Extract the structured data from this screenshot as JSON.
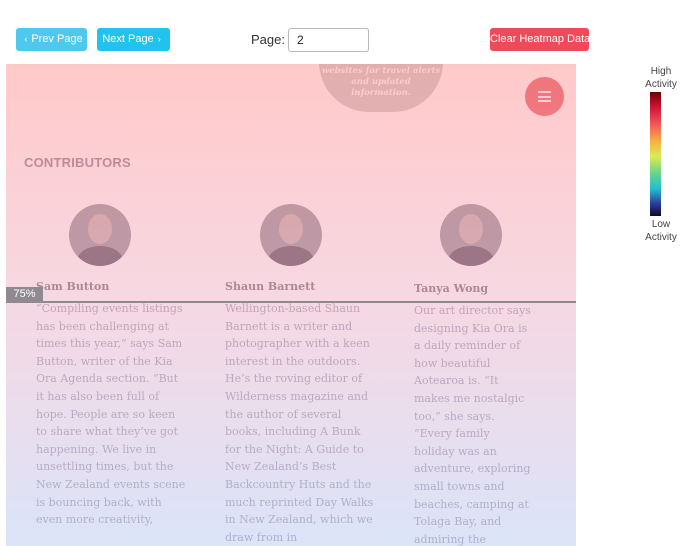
{
  "toolbar": {
    "prev_label": "Prev Page",
    "next_label": "Next Page",
    "page_label": "Page:",
    "page_value": "2",
    "clear_label": "Clear Heatmap Data"
  },
  "page": {
    "callout_lines": [
      "websites for travel alerts",
      "and updated",
      "information."
    ],
    "section_title": "CONTRIBUTORS",
    "fold_percent": "75%",
    "contributors": [
      {
        "name": "Sam Button",
        "bio": "“Compiling events listings has been challenging at times this year,” says Sam Button, writer of the Kia Ora Agenda section. “But it has also been full of hope. People are so keen to share what they’ve got happening. We live in unsettling times, but the New Zealand events scene is bouncing back, with even more creativity,"
      },
      {
        "name": "Shaun Barnett",
        "bio": "Wellington-based Shaun Barnett is a writer and photographer with a keen interest in the outdoors. He’s the roving editor of Wilderness magazine and the author of several books, including A Bunk for the Night: A Guide to New Zealand’s Best Backcountry Huts and the much reprinted Day Walks in New Zealand, which we draw from in"
      },
      {
        "name": "Tanya Wong",
        "bio": "Our art director says designing Kia Ora is a daily reminder of how beautiful Aotearoa is. “It makes me nostalgic too,” she says. “Every family holiday was an adventure, exploring small towns and beaches, camping at Tolaga Bay, and admiring the landscapes. I have a"
      }
    ]
  },
  "legend": {
    "high_line1": "High",
    "high_line2": "Activity",
    "low_line1": "Low",
    "low_line2": "Activity"
  },
  "colors": {
    "prev_button": "#4fc8ee",
    "next_button": "#22c2ee",
    "clear_button": "#f04a5a",
    "menu_button": "#e8737c"
  }
}
